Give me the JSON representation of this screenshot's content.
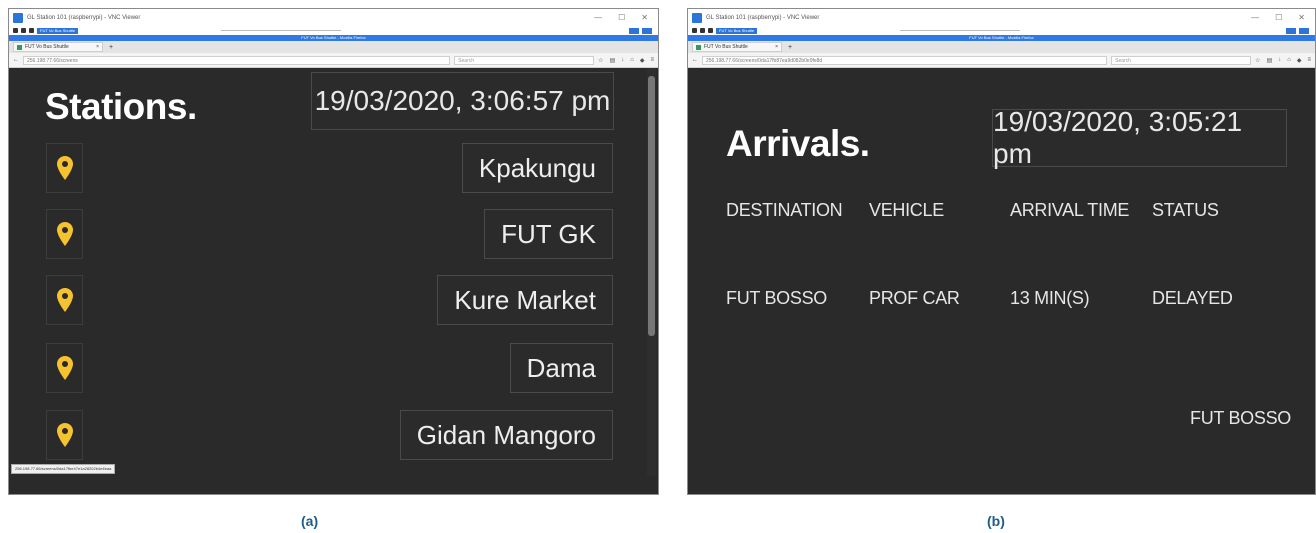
{
  "vnc": {
    "title_a": "GL Station 101 (raspberrypi) - VNC Viewer",
    "title_b": "GL Station 101 (raspberrypi) - VNC Viewer",
    "host_banner": "FUT Vo Bus Shuttle - Mozilla Firefox",
    "window_controls": [
      "—",
      "☐",
      "✕"
    ]
  },
  "browser": {
    "tab_label": "FUT Vo Bus Shuttle",
    "new_tab": "+",
    "url": "256.198.77.66/screens",
    "url_b": "256.198.77.66/screens/0da17fb87ea9d082b0e9fe8d",
    "search_placeholder": "Search",
    "status_link": "256.198.77.66/screens/0da17fbe47e1a28202b4e4baa"
  },
  "screen_a": {
    "heading": "Stations.",
    "clock": "19/03/2020, 3:06:57 pm",
    "stations": [
      "Kpakungu",
      "FUT GK",
      "Kure Market",
      "Dama",
      "Gidan Mangoro"
    ]
  },
  "screen_b": {
    "heading": "Arrivals.",
    "clock": "19/03/2020, 3:05:21 pm",
    "columns": [
      "DESTINATION",
      "VEHICLE",
      "ARRIVAL TIME",
      "STATUS"
    ],
    "rows": [
      {
        "destination": "FUT BOSSO",
        "vehicle": "PROF CAR",
        "arrival_time": "13 MIN(S)",
        "status": "DELAYED"
      }
    ],
    "footer_location": "FUT BOSSO"
  },
  "captions": {
    "a": "(a)",
    "b": "(b)"
  },
  "colors": {
    "background": "#2a2a2a",
    "pin": "#f5c330",
    "caption": "#1e5c8c"
  }
}
